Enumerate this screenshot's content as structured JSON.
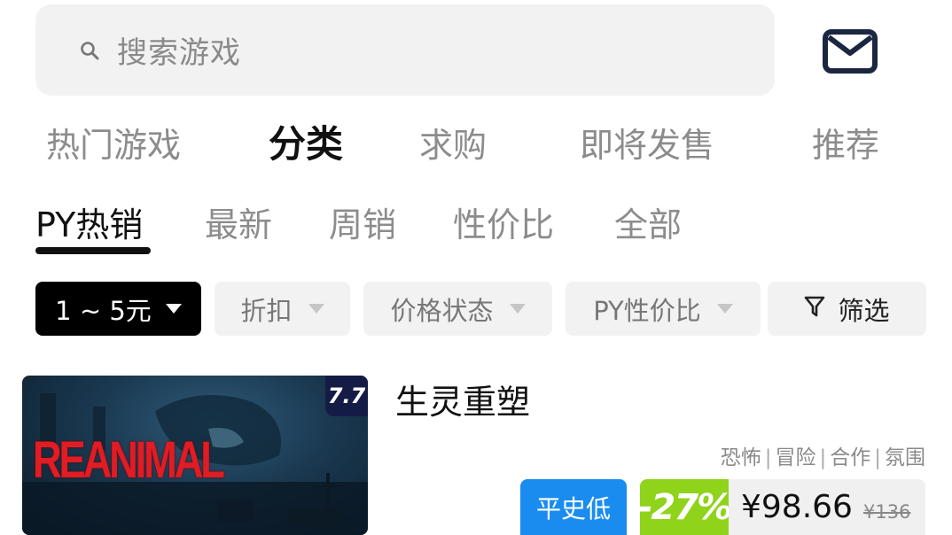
{
  "search": {
    "placeholder": "搜索游戏"
  },
  "main_tabs": [
    {
      "label": "热门游戏"
    },
    {
      "label": "分类"
    },
    {
      "label": "求购"
    },
    {
      "label": "即将发售"
    },
    {
      "label": "推荐"
    }
  ],
  "main_tabs_active": "分类",
  "sub_tabs": [
    {
      "label": "PY热销"
    },
    {
      "label": "最新"
    },
    {
      "label": "周销"
    },
    {
      "label": "性价比"
    },
    {
      "label": "全部"
    }
  ],
  "sub_tabs_active": "PY热销",
  "filters": {
    "price_range": "1 ~ 5元",
    "discount": "折扣",
    "price_status": "价格状态",
    "py_value": "PY性价比",
    "screen": "筛选"
  },
  "game": {
    "title": "生灵重塑",
    "cover_art_text": "REANIMAL",
    "score": "7.7",
    "tags": [
      "恐怖",
      "冒险",
      "合作",
      "氛围"
    ],
    "low_badge": "平史低",
    "discount": "-27%",
    "price": "¥98.66",
    "original_price": "¥136"
  },
  "colors": {
    "accent_blue": "#1a8cf0",
    "discount_green": "#8fd31a",
    "art_red": "#e01c24",
    "score_bg": "#141c45"
  }
}
